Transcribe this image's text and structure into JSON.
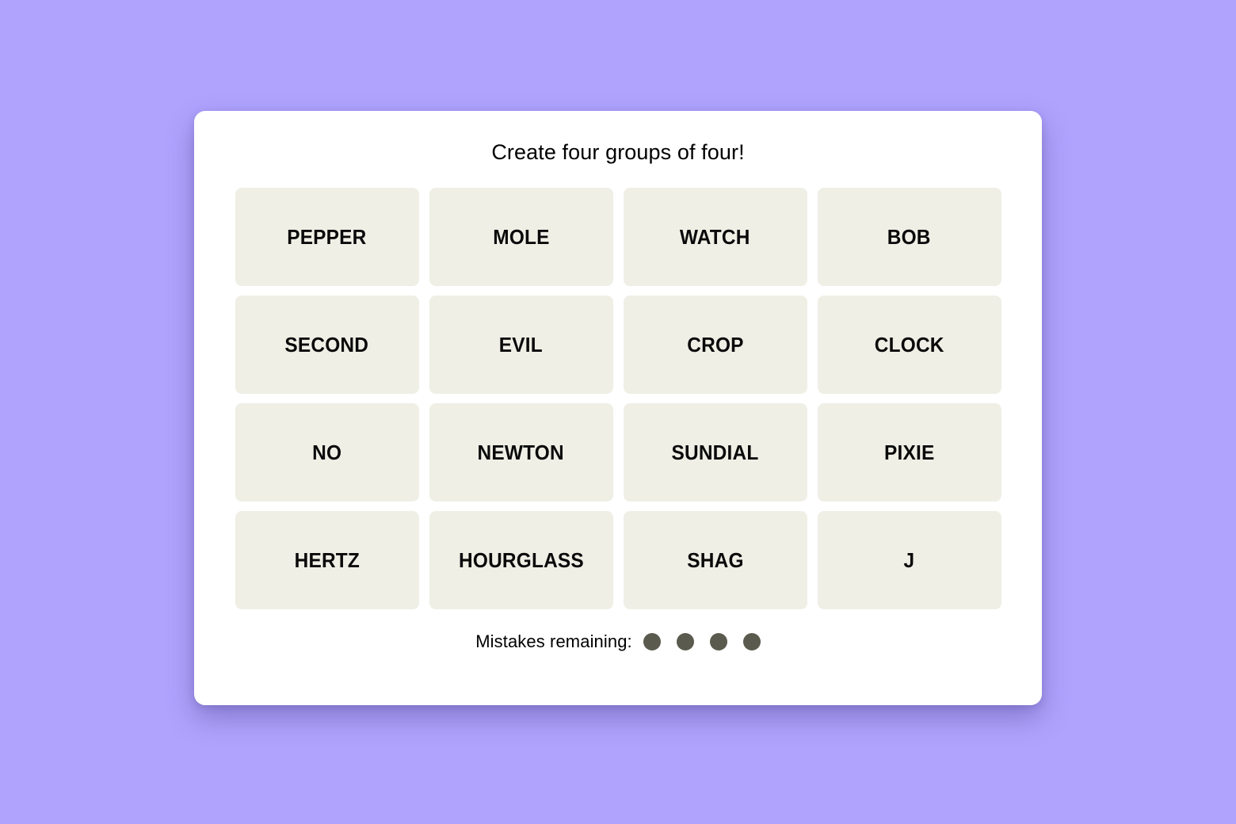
{
  "page": {
    "background_color": "#AFA3FD",
    "card_background_color": "#FFFFFF"
  },
  "game": {
    "title": "Create four groups of four!",
    "tile_background_color": "#EFEFE6",
    "tile_text_color": "#0A0A0A",
    "rows": [
      {
        "tiles": [
          {
            "label": "PEPPER"
          },
          {
            "label": "MOLE"
          },
          {
            "label": "WATCH"
          },
          {
            "label": "BOB"
          }
        ]
      },
      {
        "tiles": [
          {
            "label": "SECOND"
          },
          {
            "label": "EVIL"
          },
          {
            "label": "CROP"
          },
          {
            "label": "CLOCK"
          }
        ]
      },
      {
        "tiles": [
          {
            "label": "NO"
          },
          {
            "label": "NEWTON"
          },
          {
            "label": "SUNDIAL"
          },
          {
            "label": "PIXIE"
          }
        ]
      },
      {
        "tiles": [
          {
            "label": "HERTZ"
          },
          {
            "label": "HOURGLASS"
          },
          {
            "label": "SHAG"
          },
          {
            "label": "J"
          }
        ]
      }
    ]
  },
  "mistakes": {
    "label": "Mistakes remaining:",
    "remaining": 4,
    "dot_color": "#5A5A4E",
    "dots": [
      {
        "state": "remaining"
      },
      {
        "state": "remaining"
      },
      {
        "state": "remaining"
      },
      {
        "state": "remaining"
      }
    ]
  }
}
